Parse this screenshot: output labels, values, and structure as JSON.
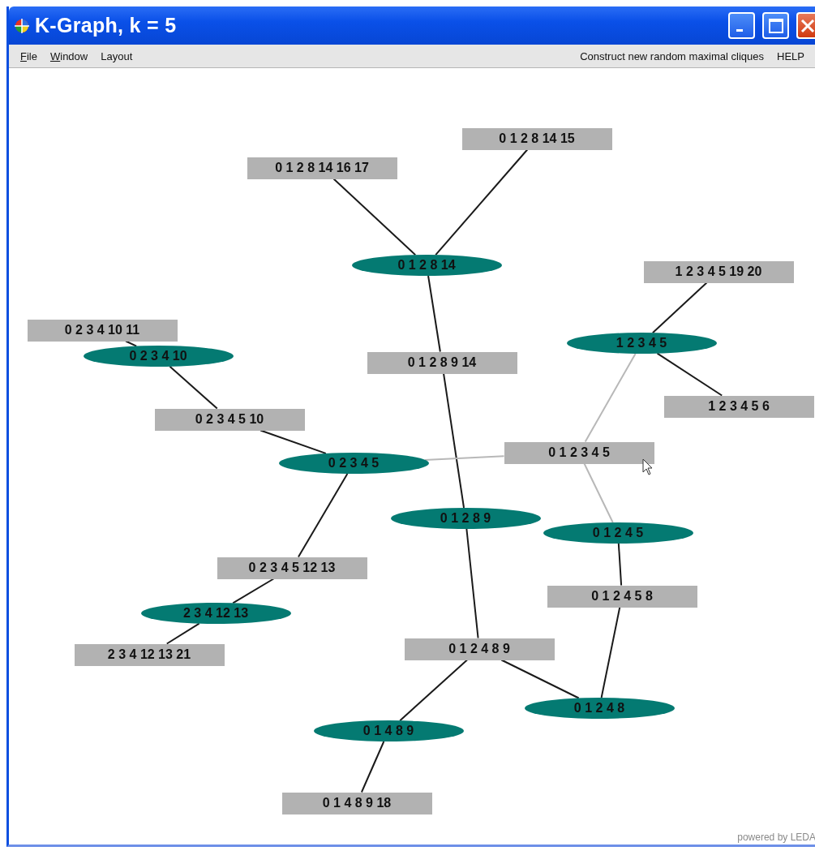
{
  "window": {
    "title": "K-Graph, k = 5"
  },
  "menu": {
    "left": [
      {
        "label": "File",
        "mnemonic": true
      },
      {
        "label": "Window",
        "mnemonic": true
      },
      {
        "label": "Layout",
        "mnemonic": false
      }
    ],
    "right": [
      {
        "label": "Construct new random maximal cliques"
      },
      {
        "label": "HELP"
      }
    ]
  },
  "graph": {
    "nodes": [
      {
        "label": "0 1 2 8 14 15",
        "kind": "separator",
        "hovered": false
      },
      {
        "label": "0 1 2 8 14 16 17",
        "kind": "separator",
        "hovered": false
      },
      {
        "label": "0 1 2 8 14",
        "kind": "clique",
        "hovered": false
      },
      {
        "label": "1 2 3 4 5 19 20",
        "kind": "separator",
        "hovered": false
      },
      {
        "label": "0 2 3 4 10 11",
        "kind": "separator",
        "hovered": false
      },
      {
        "label": "1 2 3 4 5",
        "kind": "clique",
        "hovered": false
      },
      {
        "label": "0 2 3 4 10",
        "kind": "clique",
        "hovered": false
      },
      {
        "label": "0 1 2 8 9 14",
        "kind": "separator",
        "hovered": false
      },
      {
        "label": "1 2 3 4 5 6",
        "kind": "separator",
        "hovered": false
      },
      {
        "label": "0 2 3 4 5 10",
        "kind": "separator",
        "hovered": false
      },
      {
        "label": "0 1 2 3 4 5",
        "kind": "separator",
        "hovered": true
      },
      {
        "label": "0 2 3 4 5",
        "kind": "clique",
        "hovered": false
      },
      {
        "label": "0 1 2 8 9",
        "kind": "clique",
        "hovered": false
      },
      {
        "label": "0 1 2 4 5",
        "kind": "clique",
        "hovered": false
      },
      {
        "label": "0 2 3 4 5 12 13",
        "kind": "separator",
        "hovered": false
      },
      {
        "label": "0 1 2 4 5 8",
        "kind": "separator",
        "hovered": false
      },
      {
        "label": "2 3 4 12 13",
        "kind": "clique",
        "hovered": false
      },
      {
        "label": "0 1 2 4 8 9",
        "kind": "separator",
        "hovered": false
      },
      {
        "label": "2 3 4 12 13 21",
        "kind": "separator",
        "hovered": false
      },
      {
        "label": "0 1 2 4 8",
        "kind": "clique",
        "hovered": false
      },
      {
        "label": "0 1 4 8 9",
        "kind": "clique",
        "hovered": false
      },
      {
        "label": "0 1 4 8 9 18",
        "kind": "separator",
        "hovered": false
      }
    ]
  },
  "footer": "powered by LEDA"
}
